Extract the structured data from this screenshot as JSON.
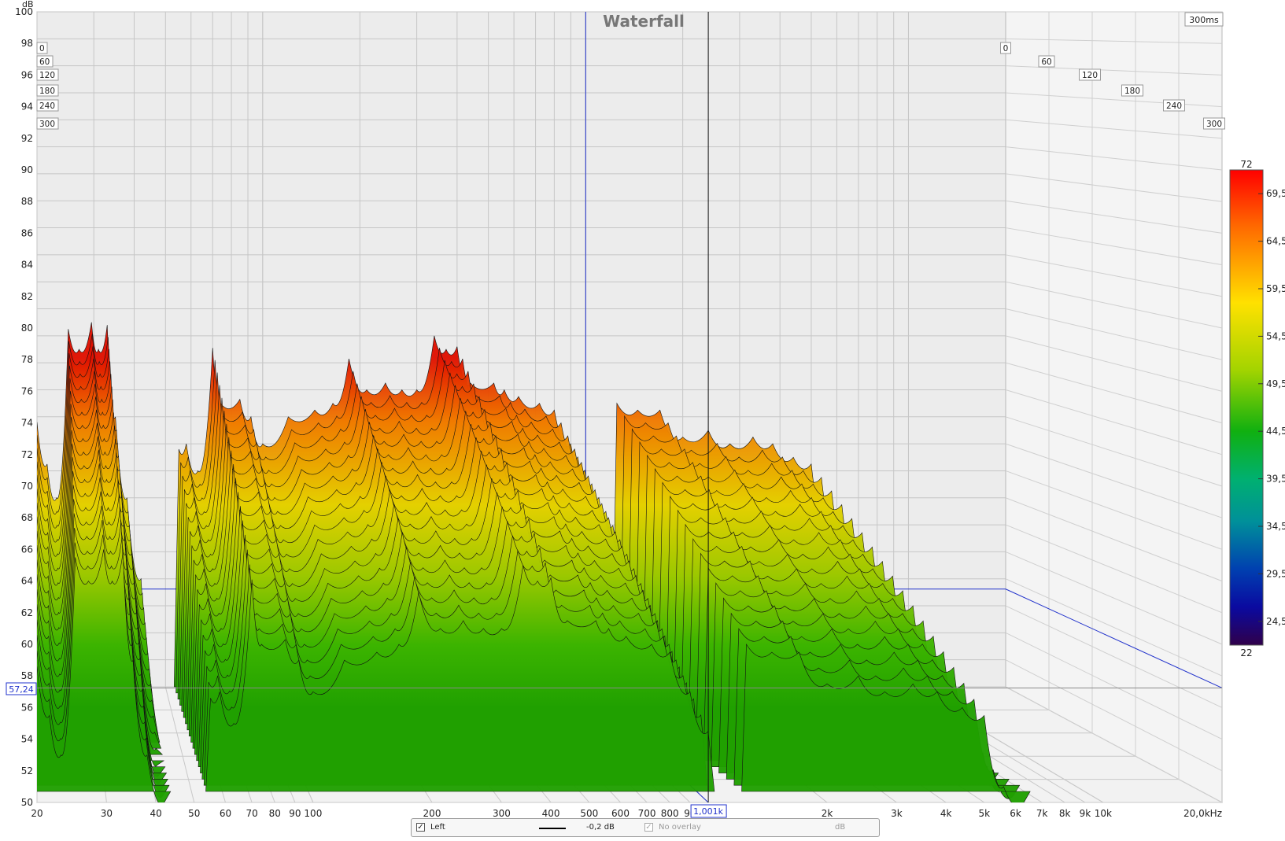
{
  "chart_data": {
    "type": "waterfall",
    "title": "Waterfall",
    "time_readout": "300ms",
    "y_unit": "dB",
    "x_unit_suffix": "kHz",
    "y_ticks": [
      "100",
      "98",
      "96",
      "94",
      "92",
      "90",
      "88",
      "86",
      "84",
      "82",
      "80",
      "78",
      "76",
      "74",
      "72",
      "70",
      "68",
      "66",
      "64",
      "62",
      "60",
      "58",
      "56",
      "54",
      "52",
      "50"
    ],
    "ylim": [
      50,
      100
    ],
    "x_ticks": [
      {
        "f": 20,
        "label": "20"
      },
      {
        "f": 30,
        "label": "30"
      },
      {
        "f": 40,
        "label": "40"
      },
      {
        "f": 50,
        "label": "50"
      },
      {
        "f": 60,
        "label": "60"
      },
      {
        "f": 70,
        "label": "70"
      },
      {
        "f": 80,
        "label": "80"
      },
      {
        "f": 90,
        "label": "90"
      },
      {
        "f": 100,
        "label": "100"
      },
      {
        "f": 200,
        "label": "200"
      },
      {
        "f": 300,
        "label": "300"
      },
      {
        "f": 400,
        "label": "400"
      },
      {
        "f": 500,
        "label": "500"
      },
      {
        "f": 600,
        "label": "600"
      },
      {
        "f": 700,
        "label": "700"
      },
      {
        "f": 800,
        "label": "800"
      },
      {
        "f": 900,
        "label": "90"
      },
      {
        "f": 2000,
        "label": "2k"
      },
      {
        "f": 3000,
        "label": "3k"
      },
      {
        "f": 4000,
        "label": "4k"
      },
      {
        "f": 5000,
        "label": "5k"
      },
      {
        "f": 6000,
        "label": "6k"
      },
      {
        "f": 7000,
        "label": "7k"
      },
      {
        "f": 8000,
        "label": "8k"
      },
      {
        "f": 9000,
        "label": "9k"
      },
      {
        "f": 10000,
        "label": "10k"
      },
      {
        "f": 20000,
        "label": "20,0kHz"
      }
    ],
    "xlim": [
      20,
      20000
    ],
    "x_scale": "log",
    "time_ticks_ms": [
      "0",
      "60",
      "120",
      "180",
      "240",
      "300"
    ],
    "left_time_ticks": [
      "0",
      "60",
      "120",
      "180",
      "240",
      "300"
    ],
    "colorbar": {
      "min_label": "22",
      "max_label": "72",
      "ticks": [
        "69,5",
        "64,5",
        "59,5",
        "54,5",
        "49,5",
        "44,5",
        "39,5",
        "34,5",
        "29,5",
        "24,5"
      ],
      "range": [
        22,
        72
      ]
    },
    "cursor": {
      "freq_label": "1,001k",
      "freq": 1001,
      "level_label": "57,24",
      "level": 57.24
    },
    "colors": {
      "blue_cursor": "#2233cc",
      "plot_bg": "#ececec",
      "grid": "#c4c4c4"
    },
    "peak_series": [
      {
        "f": 20,
        "db": 69.6
      },
      {
        "f": 21.5,
        "db": 66.5
      },
      {
        "f": 23,
        "db": 64
      },
      {
        "f": 25,
        "db": 76.5
      },
      {
        "f": 27,
        "db": 75
      },
      {
        "f": 29.5,
        "db": 77
      },
      {
        "f": 31,
        "db": 75
      },
      {
        "f": 33,
        "db": 76.8
      },
      {
        "f": 35,
        "db": 70
      },
      {
        "f": 38,
        "db": 64
      },
      {
        "f": 42,
        "db": 58
      },
      {
        "f": 55,
        "db": 67.6
      },
      {
        "f": 58,
        "db": 68
      },
      {
        "f": 63,
        "db": 66
      },
      {
        "f": 70,
        "db": 75.1
      },
      {
        "f": 74,
        "db": 71
      },
      {
        "f": 85,
        "db": 71.3
      },
      {
        "f": 92,
        "db": 70
      },
      {
        "f": 100,
        "db": 68
      },
      {
        "f": 120,
        "db": 70
      },
      {
        "f": 145,
        "db": 70.5
      },
      {
        "f": 165,
        "db": 71
      },
      {
        "f": 185,
        "db": 74.3
      },
      {
        "f": 210,
        "db": 72
      },
      {
        "f": 240,
        "db": 72.5
      },
      {
        "f": 270,
        "db": 72
      },
      {
        "f": 300,
        "db": 72
      },
      {
        "f": 340,
        "db": 76
      },
      {
        "f": 370,
        "db": 75
      },
      {
        "f": 400,
        "db": 75.2
      },
      {
        "f": 440,
        "db": 72.5
      },
      {
        "f": 520,
        "db": 72.5
      },
      {
        "f": 560,
        "db": 72
      },
      {
        "f": 620,
        "db": 71.5
      },
      {
        "f": 720,
        "db": 71
      },
      {
        "f": 800,
        "db": 70.5
      },
      {
        "f": 900,
        "db": 68
      },
      {
        "f": 1000,
        "db": 65.5
      },
      {
        "f": 1250,
        "db": 71
      },
      {
        "f": 1450,
        "db": 70.5
      },
      {
        "f": 1700,
        "db": 70.5
      },
      {
        "f": 2000,
        "db": 68.5
      },
      {
        "f": 2400,
        "db": 69
      },
      {
        "f": 2800,
        "db": 68
      },
      {
        "f": 3300,
        "db": 68.5
      },
      {
        "f": 3800,
        "db": 68
      },
      {
        "f": 4400,
        "db": 67
      },
      {
        "f": 5000,
        "db": 66.5
      },
      {
        "f": 5600,
        "db": 62
      },
      {
        "f": 6300,
        "db": 58
      }
    ]
  },
  "legend": {
    "series_label": "Left",
    "offset_value": "-0,2 dB",
    "overlay_label": "No overlay",
    "overlay_unit": "dB",
    "series_checked": "✓",
    "overlay_checked": "✓"
  }
}
